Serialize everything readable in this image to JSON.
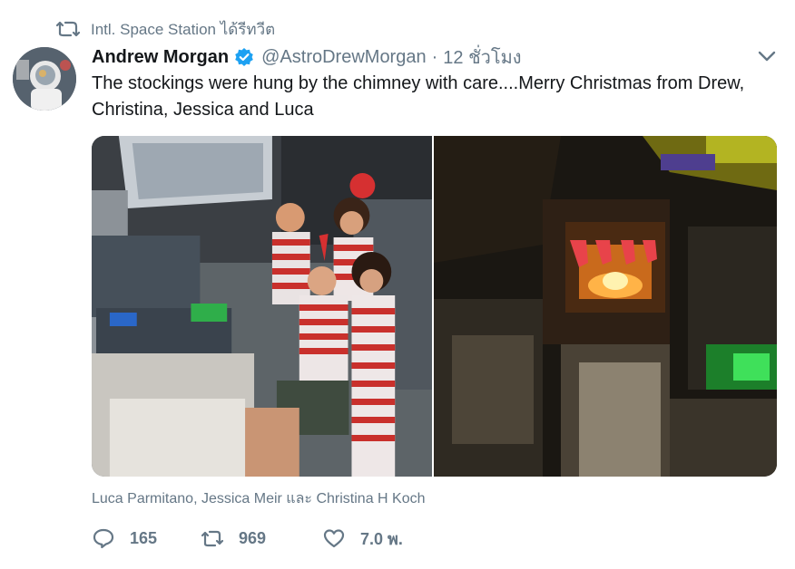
{
  "retweet_context": {
    "text": "Intl. Space Station ได้รีทวีต",
    "icon": "retweet-icon"
  },
  "author": {
    "name": "Andrew Morgan",
    "handle": "@AstroDrewMorgan",
    "separator": "·",
    "time": "12 ชั่วโมง",
    "verified": true
  },
  "tweet": {
    "text": "The stockings were hung by the chimney with care....Merry Christmas from Drew, Christina, Jessica and Luca"
  },
  "media": {
    "photos": [
      {
        "alt": "Four astronauts in red and white striped pajamas inside the space station"
      },
      {
        "alt": "Space station module with stockings hung above a fireplace screen"
      }
    ]
  },
  "tagged_people": "Luca Parmitano, Jessica Meir และ Christina H Koch",
  "actions": {
    "replies": "165",
    "retweets": "969",
    "likes": "7.0 พ."
  },
  "colors": {
    "muted": "#657786",
    "text": "#14171a",
    "verified": "#1da1f2"
  }
}
